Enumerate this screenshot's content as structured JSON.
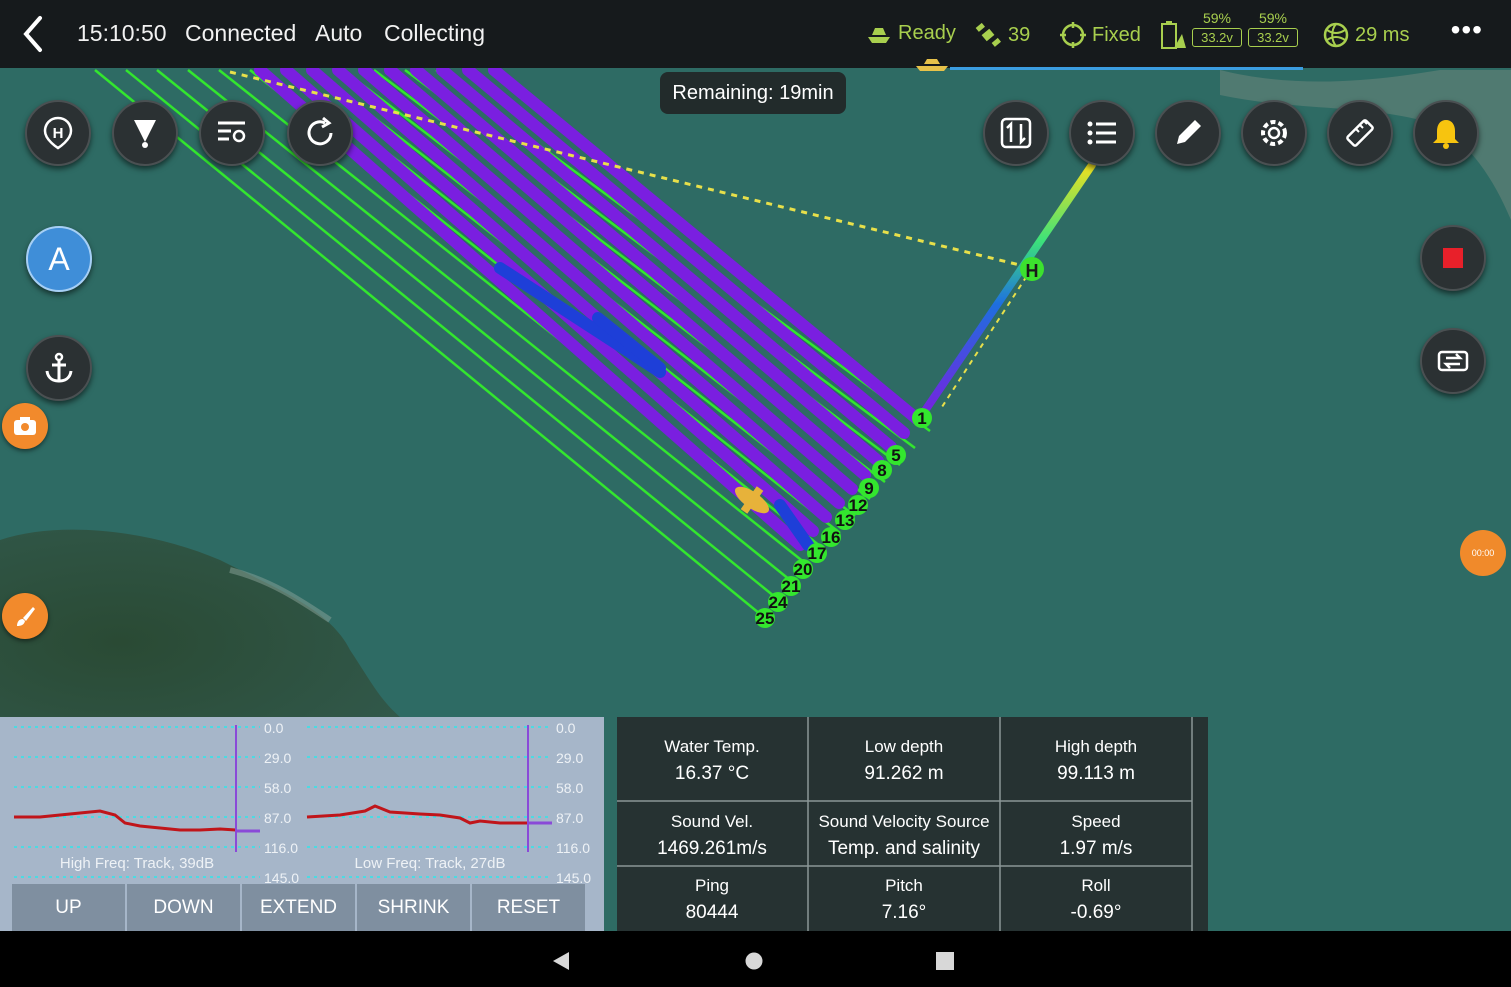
{
  "topbar": {
    "time": "15:10:50",
    "connection": "Connected",
    "mode": "Auto",
    "state": "Collecting",
    "boat_status": "Ready",
    "satellites": "39",
    "fix": "Fixed",
    "battery": [
      {
        "percent": "59%",
        "voltage": "33.2v"
      },
      {
        "percent": "59%",
        "voltage": "33.2v"
      }
    ],
    "latency": "29 ms",
    "mission_progress": 0.37
  },
  "map": {
    "remaining": "Remaining: 19min",
    "home_marker": "H",
    "line_numbers": [
      "1",
      "5",
      "8",
      "9",
      "12",
      "13",
      "16",
      "17",
      "20",
      "21",
      "24",
      "25"
    ]
  },
  "buttons": {
    "a_label": "A"
  },
  "timer_badge": "00:00",
  "sonar": {
    "ticks": [
      "0.0",
      "29.0",
      "58.0",
      "87.0",
      "116.0",
      "145.0"
    ],
    "high_caption": "High Freq: Track, 39dB",
    "low_caption": "Low Freq: Track, 27dB",
    "controls": [
      "UP",
      "DOWN",
      "EXTEND",
      "SHRINK",
      "RESET"
    ]
  },
  "info": [
    {
      "label": "Water Temp.",
      "value": "16.37 °C"
    },
    {
      "label": "Low depth",
      "value": "91.262 m"
    },
    {
      "label": "High depth",
      "value": "99.113 m"
    },
    {
      "label": "Sound Vel.",
      "value": "1469.261m/s"
    },
    {
      "label": "Sound Velocity Source",
      "value": "Temp. and salinity"
    },
    {
      "label": "Speed",
      "value": "1.97 m/s"
    },
    {
      "label": "Ping",
      "value": "80444"
    },
    {
      "label": "Pitch",
      "value": "7.16°"
    },
    {
      "label": "Roll",
      "value": "-0.69°"
    }
  ],
  "colors": {
    "planned_line": "#33e62e",
    "track": "#7a1fe0",
    "track_alt": "#1e3fd8",
    "accent_ok": "#a8cf4e",
    "depth_trace": "#c0151a"
  }
}
